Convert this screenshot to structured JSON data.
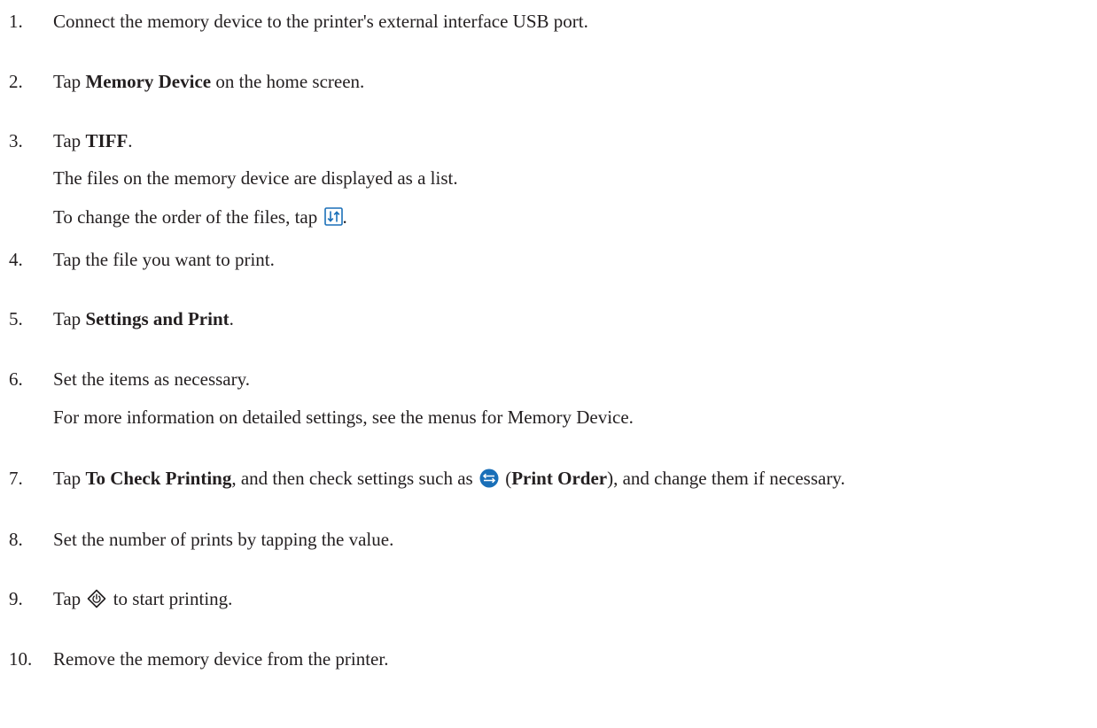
{
  "steps": [
    {
      "num": "1.",
      "text": "Connect the memory device to the printer's external interface USB port."
    },
    {
      "num": "2.",
      "pre": "Tap ",
      "bold": "Memory Device",
      "post": " on the home screen."
    },
    {
      "num": "3.",
      "pre": "Tap ",
      "bold": "TIFF",
      "post": ".",
      "notes": [
        "The files on the memory device are displayed as a list.",
        {
          "pre": "To change the order of the files, tap ",
          "post": "."
        }
      ]
    },
    {
      "num": "4.",
      "text": "Tap the file you want to print."
    },
    {
      "num": "5.",
      "pre": "Tap ",
      "bold": "Settings and Print",
      "post": "."
    },
    {
      "num": "6.",
      "text": "Set the items as necessary.",
      "notes": [
        "For more information on detailed settings, see the menus for Memory Device."
      ]
    },
    {
      "num": "7.",
      "pre": "Tap ",
      "bold": "To Check Printing",
      "mid": ", and then check settings such as ",
      "paren_open": " (",
      "bold2": "Print Order",
      "post": "), and change them if necessary."
    },
    {
      "num": "8.",
      "text": "Set the number of prints by tapping the value."
    },
    {
      "num": "9.",
      "pre": "Tap ",
      "post": " to start printing."
    },
    {
      "num": "10.",
      "text": "Remove the memory device from the printer."
    }
  ],
  "icons": {
    "sort": "sort-order-icon",
    "print_order": "print-order-icon",
    "start": "start-icon"
  },
  "colors": {
    "text": "#231f20",
    "icon_blue": "#1a6fb8"
  }
}
